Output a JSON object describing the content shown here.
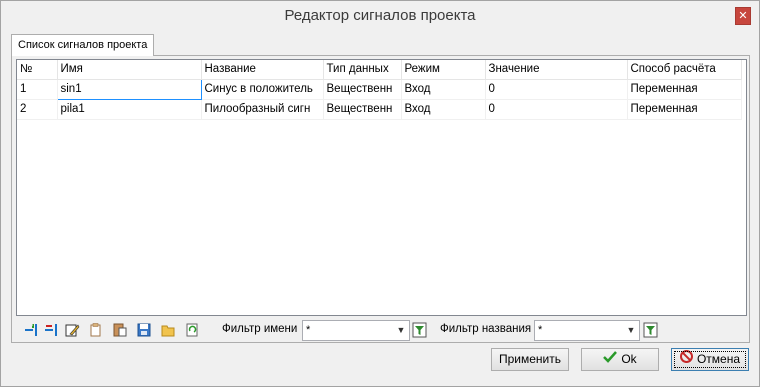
{
  "window": {
    "title": "Редактор сигналов проекта",
    "close_glyph": "✕"
  },
  "tab": {
    "label": "Список сигналов проекта"
  },
  "table": {
    "columns": [
      "№",
      "Имя",
      "Название",
      "Тип данных",
      "Режим",
      "Значение",
      "Способ расчёта"
    ],
    "rows": [
      [
        "1",
        "sin1",
        "Синус в положитель",
        "Вещественн",
        "Вход",
        "0",
        "Переменная"
      ],
      [
        "2",
        "pila1",
        "Пилообразный сигн",
        "Вещественн",
        "Вход",
        "0",
        "Переменная"
      ]
    ]
  },
  "toolbar": {
    "icons": [
      "add-row-icon",
      "delete-row-icon",
      "edit-icon",
      "copy-icon",
      "paste-icon",
      "save-icon",
      "open-folder-icon",
      "refresh-icon"
    ],
    "name_filter_label": "Фильтр имени",
    "name_filter_value": "*",
    "title_filter_label": "Фильтр названия",
    "title_filter_value": "*"
  },
  "buttons": {
    "apply": "Применить",
    "ok": "Ok",
    "cancel": "Отмена"
  }
}
